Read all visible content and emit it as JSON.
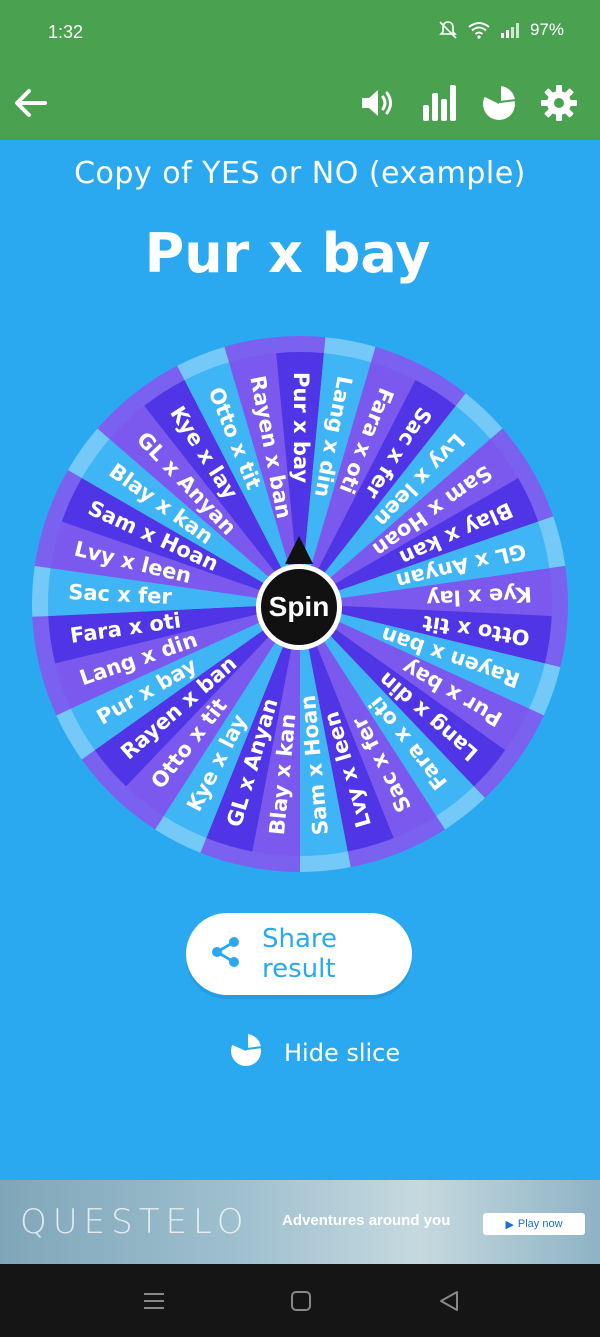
{
  "status_bar": {
    "time": "1:32",
    "battery": "97%"
  },
  "app_bar": {
    "icons": [
      "back-arrow-icon",
      "volume-icon",
      "bar-chart-icon",
      "pie-chart-icon",
      "gear-icon"
    ]
  },
  "subtitle": "Copy of YES or NO (example)",
  "result": "Pur x bay",
  "wheel": {
    "entries": [
      "Pur x bay",
      "Lang x din",
      "Fara x oti",
      "Sac x fer",
      "Lvy x leen",
      "Sam x Hoan",
      "Blay x kan",
      "GL x Anyan",
      "Kye x lay",
      "Otto x tit",
      "Rayen x ban"
    ],
    "repeats": 3,
    "colors": {
      "dark": "#4f35e6",
      "mid": "#7b59ee",
      "light": "#40b5f5",
      "rim_dark": "#7b61f0",
      "rim_light": "#74c9f8"
    }
  },
  "spin_label": "Spin",
  "share_label": "Share result",
  "hide_slice_label": "Hide slice",
  "ad": {
    "brand": "QUESTELO",
    "tagline": "Adventures around you",
    "cta": "Play now"
  },
  "colors": {
    "appbar": "#4aa14f",
    "background": "#2aa9f1"
  }
}
